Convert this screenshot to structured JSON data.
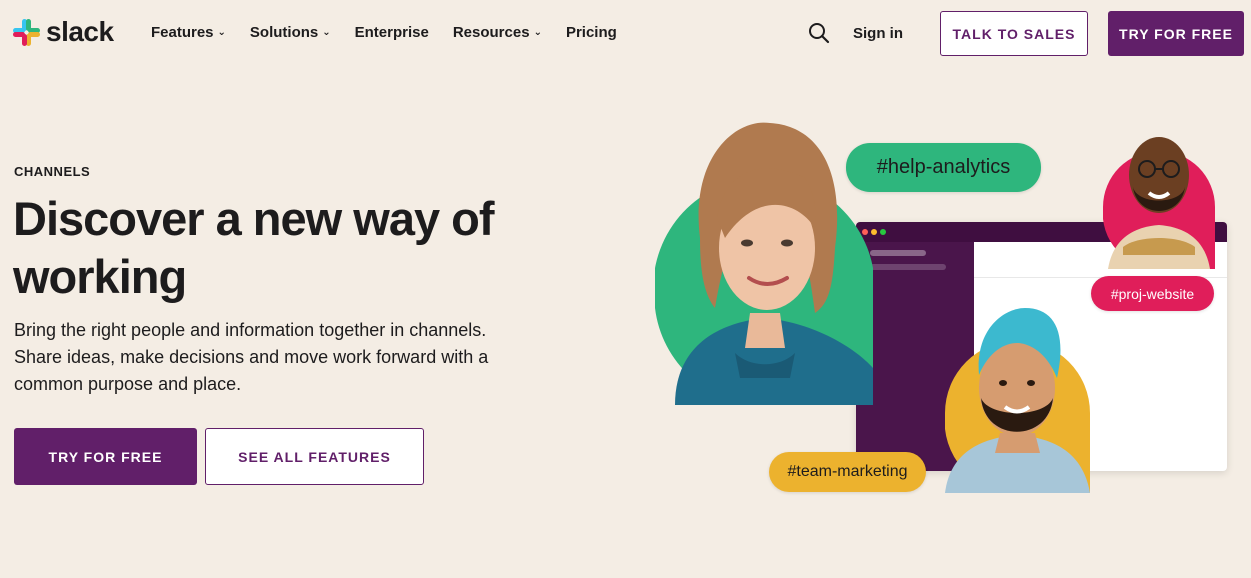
{
  "nav": {
    "logo_text": "slack",
    "links": [
      {
        "label": "Features",
        "has_dropdown": true
      },
      {
        "label": "Solutions",
        "has_dropdown": true
      },
      {
        "label": "Enterprise",
        "has_dropdown": false
      },
      {
        "label": "Resources",
        "has_dropdown": true
      },
      {
        "label": "Pricing",
        "has_dropdown": false
      }
    ],
    "search_icon": "search-icon",
    "sign_in": "Sign in",
    "talk_to_sales": "TALK TO SALES",
    "try_for_free": "TRY FOR FREE"
  },
  "hero": {
    "eyebrow": "CHANNELS",
    "headline": "Discover a new way of working",
    "description": "Bring the right people and information together in channels. Share ideas, make decisions and move work forward with a common purpose and place.",
    "primary_cta": "TRY FOR FREE",
    "secondary_cta": "SEE ALL FEATURES"
  },
  "illustration": {
    "tags": [
      "#help-analytics",
      "#proj-website",
      "#team-marketing"
    ]
  },
  "colors": {
    "background": "#f4ede4",
    "aubergine": "#611f69",
    "green": "#2eb67d",
    "red": "#e01e5a",
    "yellow": "#ecb22e",
    "blue": "#36c5f0"
  }
}
